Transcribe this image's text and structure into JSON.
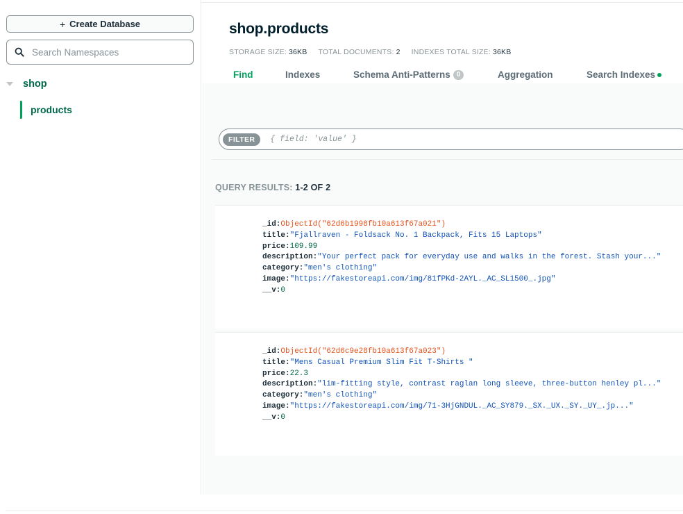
{
  "sidebar": {
    "create_button": "Create Database",
    "search_placeholder": "Search Namespaces",
    "database": "shop",
    "collection": "products"
  },
  "header": {
    "title": "shop.products",
    "stats": [
      {
        "label": "STORAGE SIZE:",
        "value": "36KB"
      },
      {
        "label": "TOTAL DOCUMENTS:",
        "value": "2"
      },
      {
        "label": "INDEXES TOTAL SIZE:",
        "value": "36KB"
      }
    ]
  },
  "tabs": [
    {
      "label": "Find",
      "active": true
    },
    {
      "label": "Indexes"
    },
    {
      "label": "Schema Anti-Patterns",
      "count": "0"
    },
    {
      "label": "Aggregation"
    },
    {
      "label": "Search Indexes"
    }
  ],
  "filter": {
    "pill": "FILTER",
    "placeholder": "{ field: 'value' }"
  },
  "results": {
    "label": "QUERY RESULTS:",
    "range": "1-2 OF 2"
  },
  "documents": [
    {
      "_id": "ObjectId(\"62d6b1998fb10a613f67a021\")",
      "title": "\"Fjallraven - Foldsack No. 1 Backpack, Fits 15 Laptops\"",
      "price": "109.99",
      "description": "\"Your perfect pack for everyday use and walks in the forest. Stash your...\"",
      "category": "\"men's clothing\"",
      "image": "\"https://fakestoreapi.com/img/81fPKd-2AYL._AC_SL1500_.jpg\"",
      "__v": "0"
    },
    {
      "_id": "ObjectId(\"62d6c9e28fb10a613f67a023\")",
      "title": "\"Mens Casual Premium Slim Fit T-Shirts \"",
      "price": "22.3",
      "description": "\"lim-fitting style, contrast raglan long sleeve, three-button henley pl...\"",
      "category": "\"men's clothing\"",
      "image": "\"https://fakestoreapi.com/img/71-3HjGNDUL._AC_SY879._SX._UX._SY._UY_.jp...\"",
      "__v": "0"
    }
  ],
  "field_keys": {
    "id": "_id:",
    "title": "title:",
    "price": "price:",
    "description": "description:",
    "category": "category:",
    "image": "image:",
    "v": "__v:"
  },
  "colors": {
    "accent_green": "#00a35c",
    "dark_green": "#00684a",
    "objectid_orange": "#e3521c",
    "string_blue": "#1254b7"
  }
}
